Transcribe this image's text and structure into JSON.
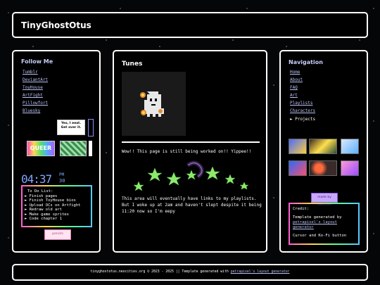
{
  "header": {
    "title": "TinyGhostOtus"
  },
  "left": {
    "title": "Follow Me",
    "links": [
      "Tumblr",
      "DeviantArt",
      "ToyHouse",
      "ArtFight",
      "Pillowfort",
      "Bluesky"
    ],
    "stamps": {
      "yes_i_eat": "Yes, I eeat. Get over it.",
      "queer": "QUEER"
    },
    "clock": {
      "time": "04:37",
      "seconds": "30",
      "ampm": "PM"
    },
    "todo": {
      "title": "To Do List:",
      "items": [
        "Finish pages",
        "Finish ToyHouse bios",
        "Upload OCs on Artfight",
        "Redraw old art",
        "Make game sprites",
        "Code chapter 1"
      ]
    },
    "sticker": "pencils"
  },
  "main": {
    "title": "Tunes",
    "notice": "Wow!! This page is still being worked on!! Yippee!!",
    "paragraph": "This area will eventually have links to my playlists. But I woke up at 2am and haven't slept despite it being 11:20 now so I'm eepy"
  },
  "right": {
    "title": "Navigation",
    "links": [
      "Home",
      "About",
      "FAQ",
      "Art",
      "Playlists",
      "Characters"
    ],
    "projects": "► Projects",
    "badge": "made by neocities",
    "credit": {
      "title": "Credit:",
      "text": "Template generated by",
      "link": "petrapixel's layout generator",
      "extra": "Cursor and Ko-Fi button"
    }
  },
  "footer": {
    "text": "tinyghostotus.neocities.org © 2023 - 2025 || Template generated with",
    "link": "petrapixel's layout generator"
  },
  "colors": {
    "accent": "#b9c2f3",
    "panel_bg": "#000000",
    "border": "#ffffff",
    "stars": "#9fe870"
  }
}
